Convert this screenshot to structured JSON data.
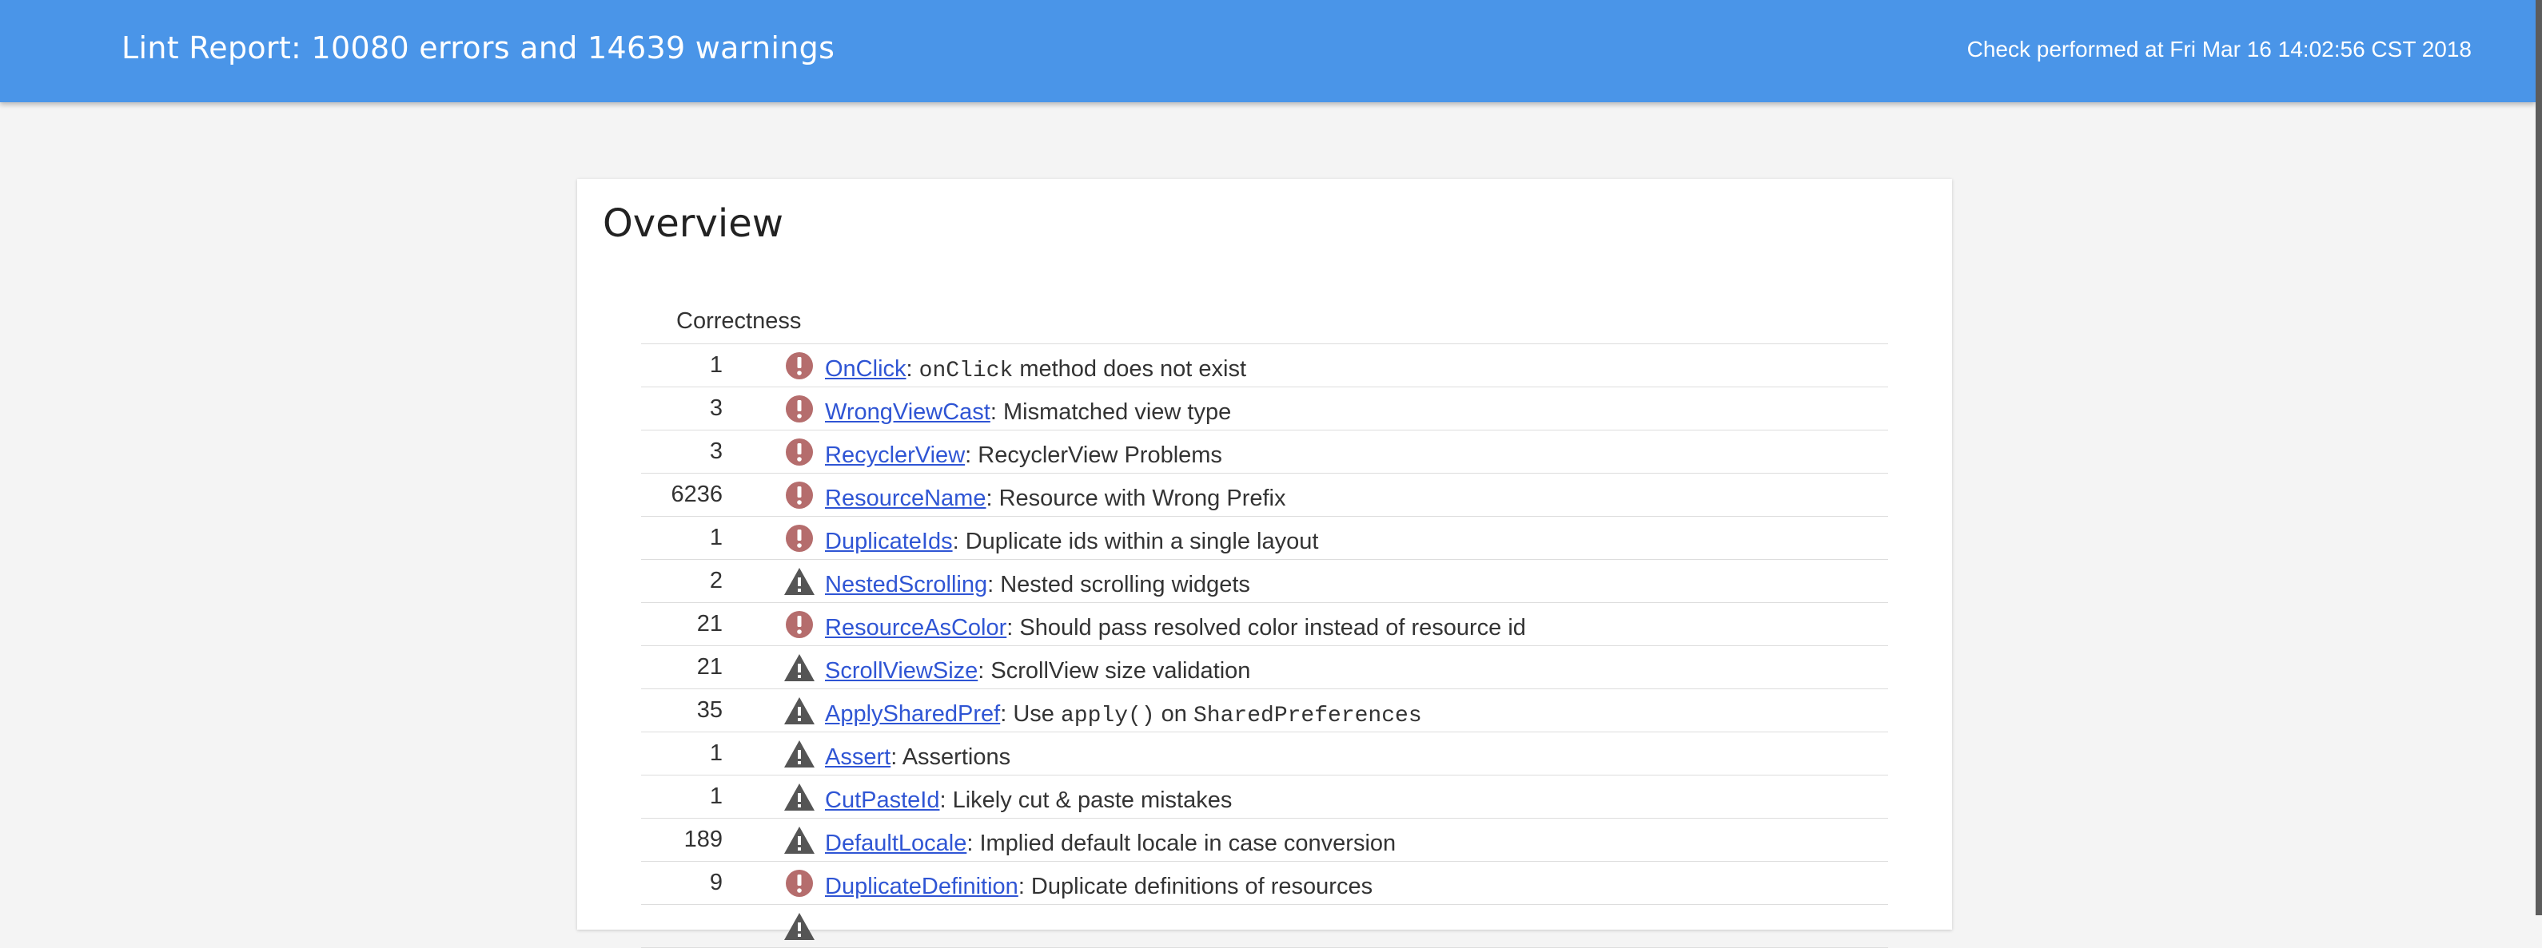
{
  "header": {
    "title": "Lint Report: 10080 errors and 14639 warnings",
    "timestamp": "Check performed at Fri Mar 16 14:02:56 CST 2018"
  },
  "overview": {
    "title": "Overview",
    "category": "Correctness",
    "rows": [
      {
        "count": "1",
        "severity": "error",
        "icon": "error-icon",
        "id": "OnClick",
        "parts": [
          ": ",
          {
            "code": "onClick"
          },
          " method does not exist"
        ]
      },
      {
        "count": "3",
        "severity": "error",
        "icon": "error-icon",
        "id": "WrongViewCast",
        "parts": [
          ": Mismatched view type"
        ]
      },
      {
        "count": "3",
        "severity": "error",
        "icon": "error-icon",
        "id": "RecyclerView",
        "parts": [
          ": RecyclerView Problems"
        ]
      },
      {
        "count": "6236",
        "severity": "error",
        "icon": "error-icon",
        "id": "ResourceName",
        "parts": [
          ": Resource with Wrong Prefix"
        ]
      },
      {
        "count": "1",
        "severity": "error",
        "icon": "error-icon",
        "id": "DuplicateIds",
        "parts": [
          ": Duplicate ids within a single layout"
        ]
      },
      {
        "count": "2",
        "severity": "warning",
        "icon": "warning-icon",
        "id": "NestedScrolling",
        "parts": [
          ": Nested scrolling widgets"
        ]
      },
      {
        "count": "21",
        "severity": "error",
        "icon": "error-icon",
        "id": "ResourceAsColor",
        "parts": [
          ": Should pass resolved color instead of resource id"
        ]
      },
      {
        "count": "21",
        "severity": "warning",
        "icon": "warning-icon",
        "id": "ScrollViewSize",
        "parts": [
          ": ScrollView size validation"
        ]
      },
      {
        "count": "35",
        "severity": "warning",
        "icon": "warning-icon",
        "id": "ApplySharedPref",
        "parts": [
          ": Use ",
          {
            "code": "apply()"
          },
          " on ",
          {
            "code": "SharedPreferences"
          }
        ]
      },
      {
        "count": "1",
        "severity": "warning",
        "icon": "warning-icon",
        "id": "Assert",
        "parts": [
          ": Assertions"
        ]
      },
      {
        "count": "1",
        "severity": "warning",
        "icon": "warning-icon",
        "id": "CutPasteId",
        "parts": [
          ": Likely cut & paste mistakes"
        ]
      },
      {
        "count": "189",
        "severity": "warning",
        "icon": "warning-icon",
        "id": "DefaultLocale",
        "parts": [
          ": Implied default locale in case conversion"
        ]
      },
      {
        "count": "9",
        "severity": "error",
        "icon": "error-icon",
        "id": "DuplicateDefinition",
        "parts": [
          ": Duplicate definitions of resources"
        ]
      },
      {
        "count": "",
        "severity": "warning",
        "icon": "warning-icon",
        "id": "",
        "parts": []
      }
    ]
  },
  "colors": {
    "header_bg": "#4a95e8",
    "link": "#2f55d4",
    "error_icon": "#b56d6d",
    "warning_icon": "#555555"
  }
}
